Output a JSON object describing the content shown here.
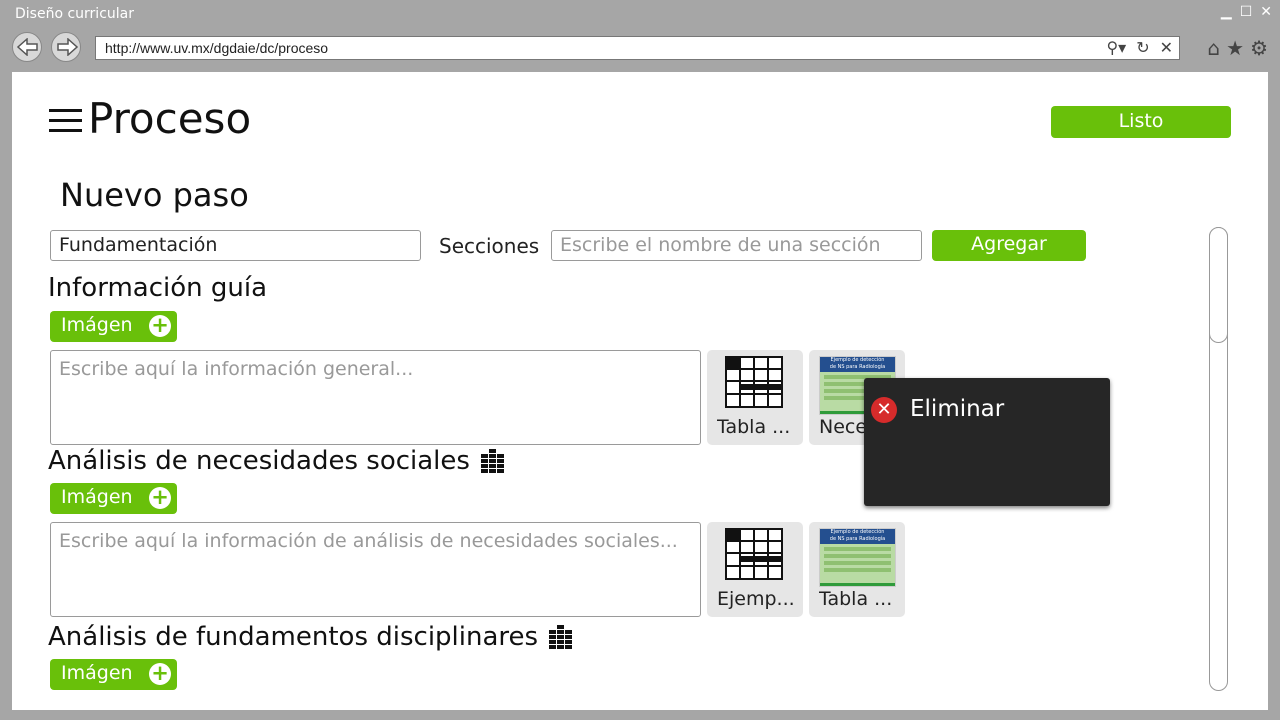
{
  "window": {
    "title": "Diseño curricular"
  },
  "browser": {
    "url": "http://www.uv.mx/dgdaie/dc/proceso"
  },
  "page": {
    "title": "Proceso",
    "done_label": "Listo"
  },
  "step": {
    "heading": "Nuevo paso",
    "name_value": "Fundamentación",
    "sections_label": "Secciones",
    "section_placeholder": "Escribe el nombre de una sección",
    "add_label": "Agregar"
  },
  "sections": [
    {
      "title": "Información guía",
      "image_button": "Imágen",
      "placeholder": "Escribe aquí la información general...",
      "thumbnails": [
        {
          "label": "Tabla ..."
        },
        {
          "label": "Nece..."
        }
      ]
    },
    {
      "title": "Análisis de necesidades sociales",
      "image_button": "Imágen",
      "placeholder": "Escribe aquí la información de análisis de necesidades sociales...",
      "thumbnails": [
        {
          "label": "Ejemp..."
        },
        {
          "label": "Tabla ..."
        }
      ]
    },
    {
      "title": "Análisis de fundamentos disciplinares",
      "image_button": "Imágen"
    }
  ],
  "doc_thumbnail": {
    "heading_line1": "Ejemplo de detección",
    "heading_line2": "de NS para Radiología"
  },
  "context_menu": {
    "delete_label": "Eliminar"
  },
  "colors": {
    "accent": "#69c00a",
    "danger": "#d62b2b",
    "popup_bg": "#262626"
  }
}
